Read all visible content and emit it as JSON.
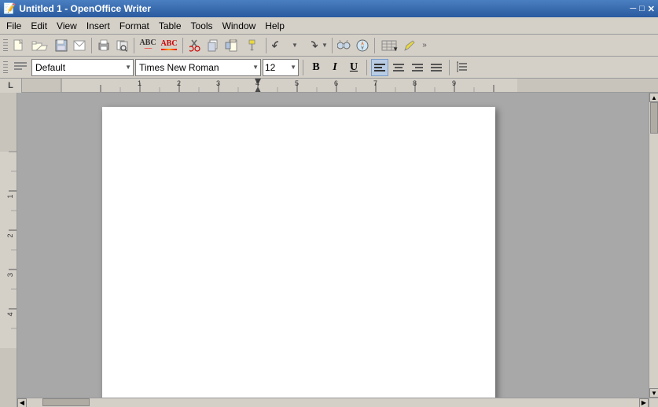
{
  "titlebar": {
    "title": "Untitled 1 - OpenOffice Writer",
    "icon": "📄"
  },
  "menubar": {
    "items": [
      "File",
      "Edit",
      "View",
      "Insert",
      "Format",
      "Table",
      "Tools",
      "Window",
      "Help"
    ]
  },
  "toolbar1": {
    "buttons": [
      {
        "name": "new-button",
        "icon": "📄",
        "label": "New"
      },
      {
        "name": "open-button",
        "icon": "📂",
        "label": "Open"
      },
      {
        "name": "save-button",
        "icon": "💾",
        "label": "Save"
      },
      {
        "name": "email-button",
        "icon": "✉️",
        "label": "Email"
      },
      {
        "name": "print-button",
        "icon": "🖨️",
        "label": "Print"
      },
      {
        "name": "preview-button",
        "icon": "🔍",
        "label": "Preview"
      },
      {
        "name": "spellcheck-button",
        "icon": "ABC",
        "label": "Spellcheck"
      },
      {
        "name": "autocorrect-button",
        "icon": "ABC",
        "label": "Autocorrect"
      },
      {
        "name": "cut-button",
        "icon": "✂️",
        "label": "Cut"
      },
      {
        "name": "copy-button",
        "icon": "📋",
        "label": "Copy"
      },
      {
        "name": "paste-button",
        "icon": "📌",
        "label": "Paste"
      },
      {
        "name": "format-paintbrush",
        "icon": "🖌️",
        "label": "Format Paintbrush"
      },
      {
        "name": "undo-button",
        "icon": "↩",
        "label": "Undo"
      },
      {
        "name": "redo-button",
        "icon": "↪",
        "label": "Redo"
      },
      {
        "name": "find-button",
        "icon": "🔭",
        "label": "Find & Replace"
      },
      {
        "name": "navigator-button",
        "icon": "🧭",
        "label": "Navigator"
      },
      {
        "name": "table-button",
        "icon": "⊞",
        "label": "Insert Table"
      },
      {
        "name": "draw-button",
        "icon": "✏️",
        "label": "Draw"
      },
      {
        "name": "more-button",
        "icon": "»",
        "label": "More"
      }
    ]
  },
  "toolbar2": {
    "style_value": "Default",
    "font_value": "Times New Roman",
    "size_value": "12",
    "bold_label": "B",
    "italic_label": "I",
    "underline_label": "U",
    "align_left_label": "≡",
    "align_center_label": "≡",
    "align_right_label": "≡",
    "align_justify_label": "≡",
    "paragraph_label": "¶"
  },
  "ruler": {
    "corner_label": "L",
    "marks": [
      1,
      2,
      3,
      4,
      5,
      6,
      7,
      8,
      9
    ]
  },
  "document": {
    "page_background": "#ffffff"
  },
  "colors": {
    "toolbar_bg": "#d4d0c8",
    "title_bg": "#2a5a9f",
    "doc_bg": "#a8a8a8"
  }
}
